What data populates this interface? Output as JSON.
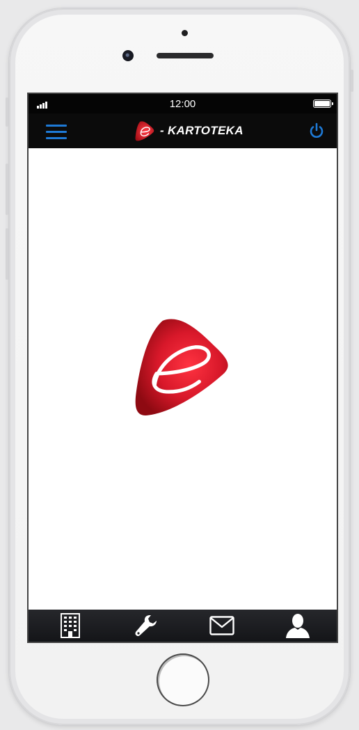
{
  "status_bar": {
    "time": "12:00"
  },
  "app_bar": {
    "brand_text": "- KARTOTEKA",
    "menu_icon": "menu-icon",
    "power_icon": "power-icon"
  },
  "tab_bar": {
    "tabs": [
      {
        "icon": "building-icon"
      },
      {
        "icon": "wrench-icon"
      },
      {
        "icon": "mail-icon"
      },
      {
        "icon": "user-icon"
      }
    ]
  },
  "colors": {
    "accent": "#1e7ad6",
    "logo_red": "#c8161e",
    "bar_background": "#0b0b0b"
  }
}
